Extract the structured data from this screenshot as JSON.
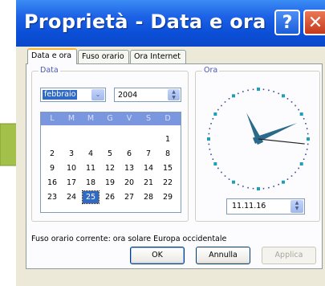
{
  "window": {
    "title": "Proprietà - Data e ora",
    "help_label": "?",
    "close_label": "✕"
  },
  "tabs": [
    {
      "label": "Data e ora",
      "active": true
    },
    {
      "label": "Fuso orario",
      "active": false
    },
    {
      "label": "Ora Internet",
      "active": false
    }
  ],
  "date_group": {
    "legend": "Data",
    "month_value": "febbraio",
    "month_arrow": "⌄",
    "year_value": "2004",
    "spin_up": "▲",
    "spin_down": "▼"
  },
  "calendar": {
    "weekdays": [
      "L",
      "M",
      "M",
      "G",
      "V",
      "S",
      "D"
    ],
    "weeks": [
      [
        "",
        "",
        "",
        "",
        "",
        "",
        "1"
      ],
      [
        "2",
        "3",
        "4",
        "5",
        "6",
        "7",
        "8"
      ],
      [
        "9",
        "10",
        "11",
        "12",
        "13",
        "14",
        "15"
      ],
      [
        "16",
        "17",
        "18",
        "19",
        "20",
        "21",
        "22"
      ],
      [
        "23",
        "24",
        "25",
        "26",
        "27",
        "28",
        "29"
      ]
    ],
    "selected_day": "25"
  },
  "time_group": {
    "legend": "Ora",
    "time_value": "11.11.16",
    "clock": {
      "hour": 11,
      "minute": 11,
      "second": 16
    }
  },
  "timezone_text": "Fuso orario corrente:  ora solare Europa occidentale",
  "buttons": {
    "ok": "OK",
    "cancel": "Annulla",
    "apply": "Applica"
  },
  "colors": {
    "titlebar": "#0b4fd8",
    "selection": "#316ac5",
    "calendar_header": "#7a96df",
    "clock_dots": "#1aa0b8",
    "clock_hands": "#2a6a8a"
  },
  "icons": {
    "side_arrow": "green-arrow-icon"
  }
}
